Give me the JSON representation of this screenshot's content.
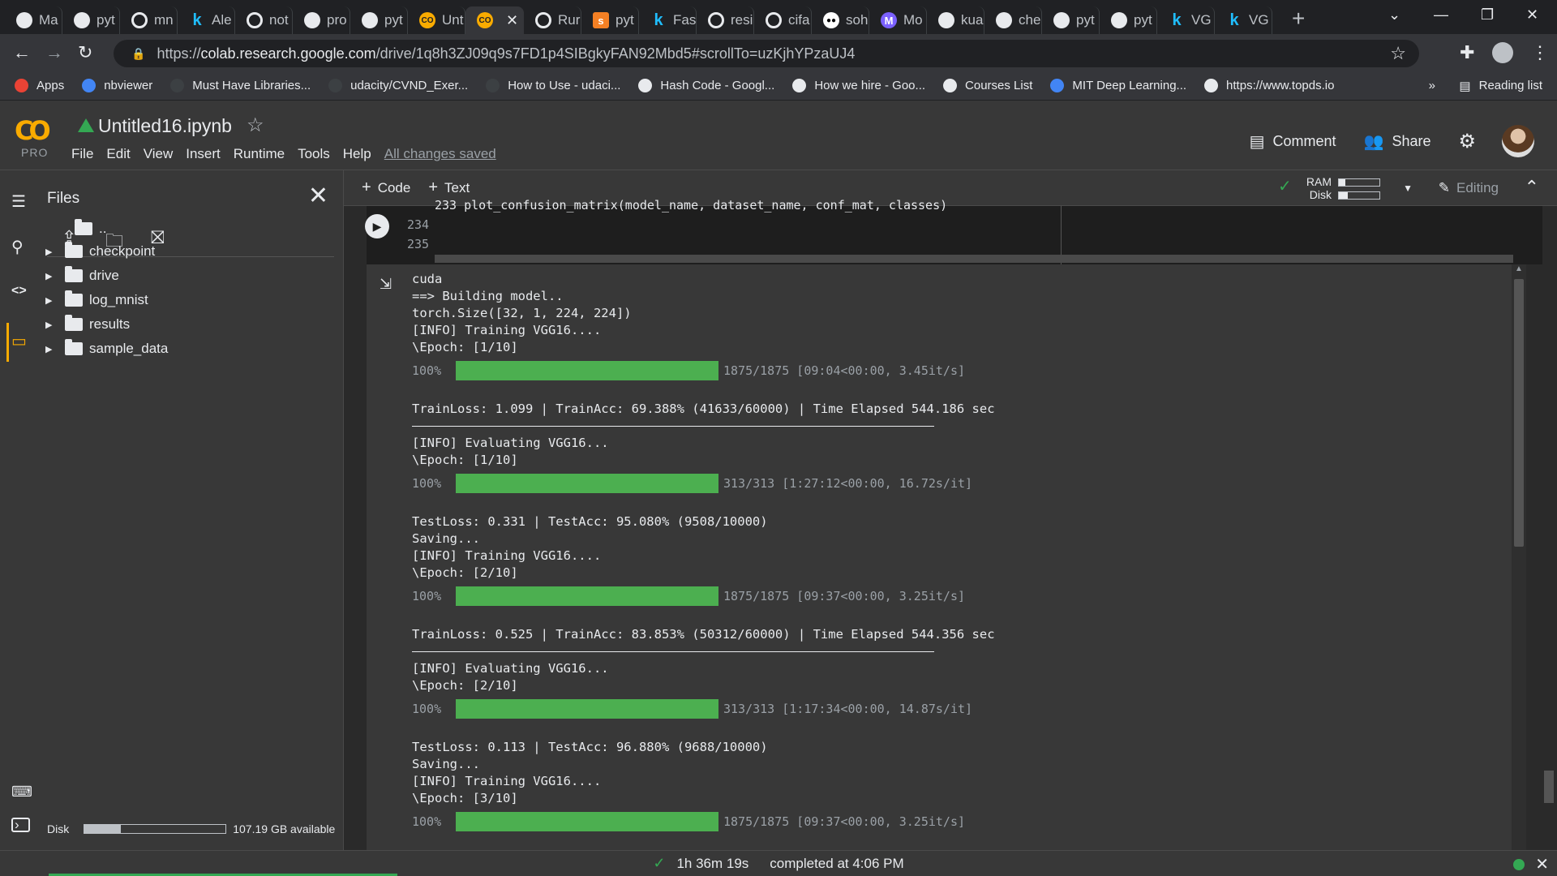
{
  "browser": {
    "tabs": [
      {
        "label": "Ma",
        "icon": "github-icon"
      },
      {
        "label": "pyt",
        "icon": "github-icon"
      },
      {
        "label": "mn",
        "icon": "google-icon"
      },
      {
        "label": "Ale",
        "icon": "kaggle-icon"
      },
      {
        "label": "not",
        "icon": "google-icon"
      },
      {
        "label": "pro",
        "icon": "github-icon"
      },
      {
        "label": "pyt",
        "icon": "github-icon"
      },
      {
        "label": "Unt",
        "icon": "colab-icon"
      },
      {
        "label": "",
        "icon": "colab-icon",
        "active": true
      },
      {
        "label": "Rur",
        "icon": "google-icon"
      },
      {
        "label": "pyt",
        "icon": "stackoverflow-icon"
      },
      {
        "label": "Fas",
        "icon": "kaggle-icon"
      },
      {
        "label": "resi",
        "icon": "google-icon"
      },
      {
        "label": "cifa",
        "icon": "google-icon"
      },
      {
        "label": "soh",
        "icon": "medium-icon"
      },
      {
        "label": "Mo",
        "icon": "m-icon"
      },
      {
        "label": "kua",
        "icon": "github-icon"
      },
      {
        "label": "che",
        "icon": "github-icon"
      },
      {
        "label": "pyt",
        "icon": "github-icon"
      },
      {
        "label": "pyt",
        "icon": "github-icon"
      },
      {
        "label": "VG",
        "icon": "kaggle-icon"
      },
      {
        "label": "VG",
        "icon": "kaggle-icon"
      }
    ],
    "url_prefix": "https://",
    "url_host": "colab.research.google.com",
    "url_path": "/drive/1q8h3ZJ09q9s7FD1p4SIBgkyFAN92Mbd5#scrollTo=uzKjhYPzaUJ4",
    "bookmarks": [
      {
        "label": "Apps",
        "color": "#ea4335"
      },
      {
        "label": "nbviewer",
        "color": "#4285f4"
      },
      {
        "label": "Must Have Libraries...",
        "color": "#3c4043"
      },
      {
        "label": "udacity/CVND_Exer...",
        "color": "#3c4043"
      },
      {
        "label": "How to Use - udaci...",
        "color": "#3c4043"
      },
      {
        "label": "Hash Code - Googl...",
        "color": "#e8eaed"
      },
      {
        "label": "How we hire - Goo...",
        "color": "#e8eaed"
      },
      {
        "label": "Courses List",
        "color": "#e8eaed"
      },
      {
        "label": "MIT Deep Learning...",
        "color": "#4285f4"
      },
      {
        "label": "https://www.topds.io",
        "color": "#e8eaed"
      }
    ],
    "more": "»",
    "reading_list": "Reading list"
  },
  "colab": {
    "logo": "CO",
    "pro": "PRO",
    "title": "Untitled16.ipynb",
    "menu": [
      "File",
      "Edit",
      "View",
      "Insert",
      "Runtime",
      "Tools",
      "Help"
    ],
    "saved_status": "All changes saved",
    "comment": "Comment",
    "share": "Share",
    "add_code": "Code",
    "add_text": "Text",
    "ram_label": "RAM",
    "disk_label": "Disk",
    "ram_usage": 0.15,
    "disk_usage": 0.22,
    "editing": "Editing"
  },
  "files": {
    "title": "Files",
    "parent": "..",
    "folders": [
      "checkpoint",
      "drive",
      "log_mnist",
      "results",
      "sample_data"
    ],
    "disk_label": "Disk",
    "disk_available": "107.19 GB available",
    "disk_usage": 0.26
  },
  "cell": {
    "code_line": "233 plot_confusion_matrix(model_name, dataset_name, conf_mat, classes)",
    "line_numbers": [
      "234",
      "235"
    ]
  },
  "output": {
    "header_lines": [
      "cuda",
      "==> Building model..",
      "torch.Size([32, 1, 224, 224])",
      "[INFO] Training VGG16....",
      "\\Epoch: [1/10]"
    ],
    "pbar1": {
      "pct": "100%",
      "info": "1875/1875 [09:04<00:00, 3.45it/s]",
      "progress": 1.0
    },
    "train1": "TrainLoss: 1.099 | TrainAcc: 69.388% (41633/60000) | Time Elapsed 544.186 sec",
    "eval1": [
      "[INFO] Evaluating VGG16...",
      "\\Epoch: [1/10]"
    ],
    "pbar2": {
      "pct": "100%",
      "info": "313/313 [1:27:12<00:00, 16.72s/it]",
      "progress": 1.0
    },
    "test1": [
      "TestLoss: 0.331 | TestAcc: 95.080% (9508/10000)",
      "Saving...",
      "[INFO] Training VGG16....",
      "\\Epoch: [2/10]"
    ],
    "pbar3": {
      "pct": "100%",
      "info": "1875/1875 [09:37<00:00, 3.25it/s]",
      "progress": 1.0
    },
    "train2": "TrainLoss: 0.525 | TrainAcc: 83.853% (50312/60000) | Time Elapsed 544.356 sec",
    "eval2": [
      "[INFO] Evaluating VGG16...",
      "\\Epoch: [2/10]"
    ],
    "pbar4": {
      "pct": "100%",
      "info": "313/313 [1:17:34<00:00, 14.87s/it]",
      "progress": 1.0
    },
    "test2": [
      "TestLoss: 0.113 | TestAcc: 96.880% (9688/10000)",
      "Saving...",
      "[INFO] Training VGG16....",
      "\\Epoch: [3/10]"
    ],
    "pbar5": {
      "pct": "100%",
      "info": "1875/1875 [09:37<00:00, 3.25it/s]",
      "progress": 1.0
    }
  },
  "status": {
    "elapsed": "1h 36m 19s",
    "completed": "completed at 4:06 PM"
  }
}
